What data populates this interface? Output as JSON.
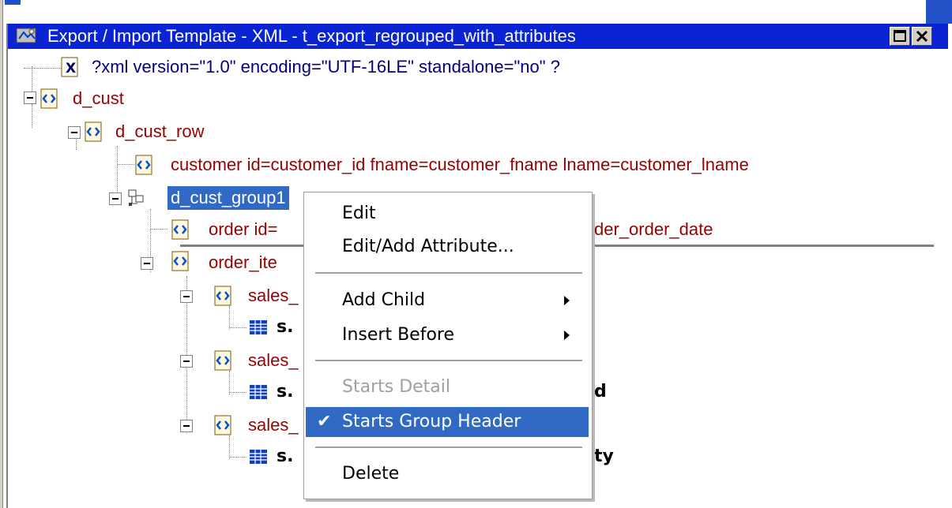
{
  "window": {
    "title": "Export / Import Template - XML - t_export_regrouped_with_attributes",
    "restore_glyph": "□",
    "close_glyph": "✕",
    "title_icon": "template-icon"
  },
  "tree": {
    "xml_decl": "?xml version=\"1.0\" encoding=\"UTF-16LE\" standalone=\"no\" ?",
    "xml_decl_icon_glyph": "X",
    "d_cust": "d_cust",
    "d_cust_row": "d_cust_row",
    "customer": "customer id=customer_id fname=customer_fname lname=customer_lname",
    "d_cust_group": "d_cust_group1",
    "order_visible_left": "order id=",
    "order_visible_right": "der_order_date",
    "order_items_visible": "order_ite",
    "sales_1": "sales_",
    "sales_1_child": "s.",
    "sales_2": "sales_",
    "sales_2_child": "s.",
    "sales_2_child_suffix": "d",
    "sales_3": "sales_",
    "sales_3_child": "s.",
    "sales_3_child_suffix": "ty"
  },
  "context_menu": {
    "items": [
      {
        "label": "Edit"
      },
      {
        "label": "Edit/Add Attribute..."
      },
      {
        "label": "Add Child",
        "submenu": true
      },
      {
        "label": "Insert Before",
        "submenu": true
      },
      {
        "label": "Starts Detail",
        "disabled": true
      },
      {
        "label": "Starts Group Header",
        "checked": true,
        "highlighted": true
      },
      {
        "label": "Delete"
      }
    ],
    "check_glyph": "✔"
  },
  "colors": {
    "title_bar": "#0a24d4",
    "selection": "#316ac5",
    "element_text": "#990000",
    "declaration_text": "#000080"
  }
}
